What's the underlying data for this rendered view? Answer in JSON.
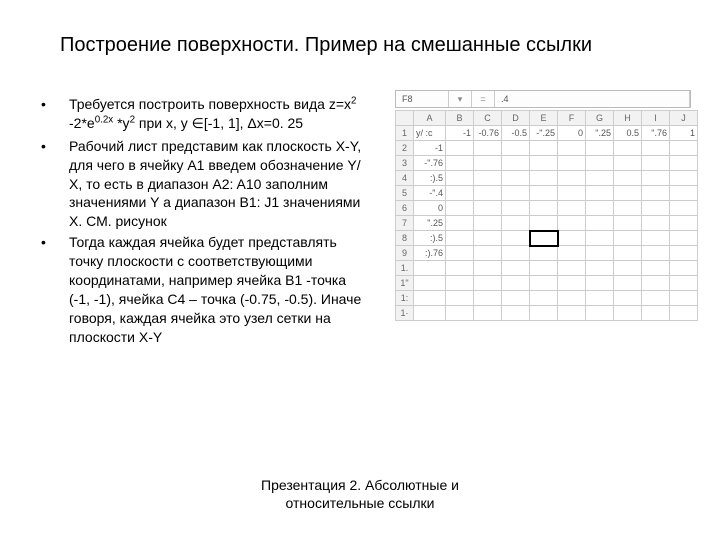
{
  "title": "Построение поверхности. Пример на смешанные ссылки",
  "bullets": [
    "Требуется построить поверхность вида z=x² -2*e⁰·²ˣ *y² при x, y ∈[-1, 1], Δx=0. 25",
    "Рабочий лист представим как плоскость X-Y, для чего в ячейку A1 введем обозначение Y/ X, то есть в диапазон A2: A10 заполним значениями Y а диапазон B1: J1 значениями X. СМ. рисунок",
    "Тогда каждая ячейка будет представлять точку плоскости с соответствующими координатами, например ячейка B1 -точка (-1, -1), ячейка С4 – точка (-0.75, -0.5). Иначе говоря, каждая ячейка это узел сетки на плоскости X-Y"
  ],
  "footer_line1": "Презентация 2. Абсолютные и",
  "footer_line2": "относительные ссылки",
  "sheet": {
    "namebox": "F8",
    "formula": ".4",
    "col_headers": [
      "A",
      "B",
      "C",
      "D",
      "E",
      "F",
      "G",
      "H",
      "I",
      "J"
    ],
    "row_headers": [
      "1",
      "2",
      "3",
      "4",
      "5",
      "6",
      "7",
      "8",
      "9",
      "1.",
      "1\"",
      "1:",
      "1·"
    ],
    "row1": [
      "y/ :c",
      "-1",
      "-0.76",
      "-0.5",
      "-\".25",
      "0",
      "\".25",
      "0.5",
      "\".76",
      "1"
    ],
    "colA": [
      "-1",
      "-\".76",
      ":).5",
      "-\".4",
      "0",
      "\".25",
      ":).5",
      ":).76",
      "",
      "",
      "",
      ""
    ]
  }
}
